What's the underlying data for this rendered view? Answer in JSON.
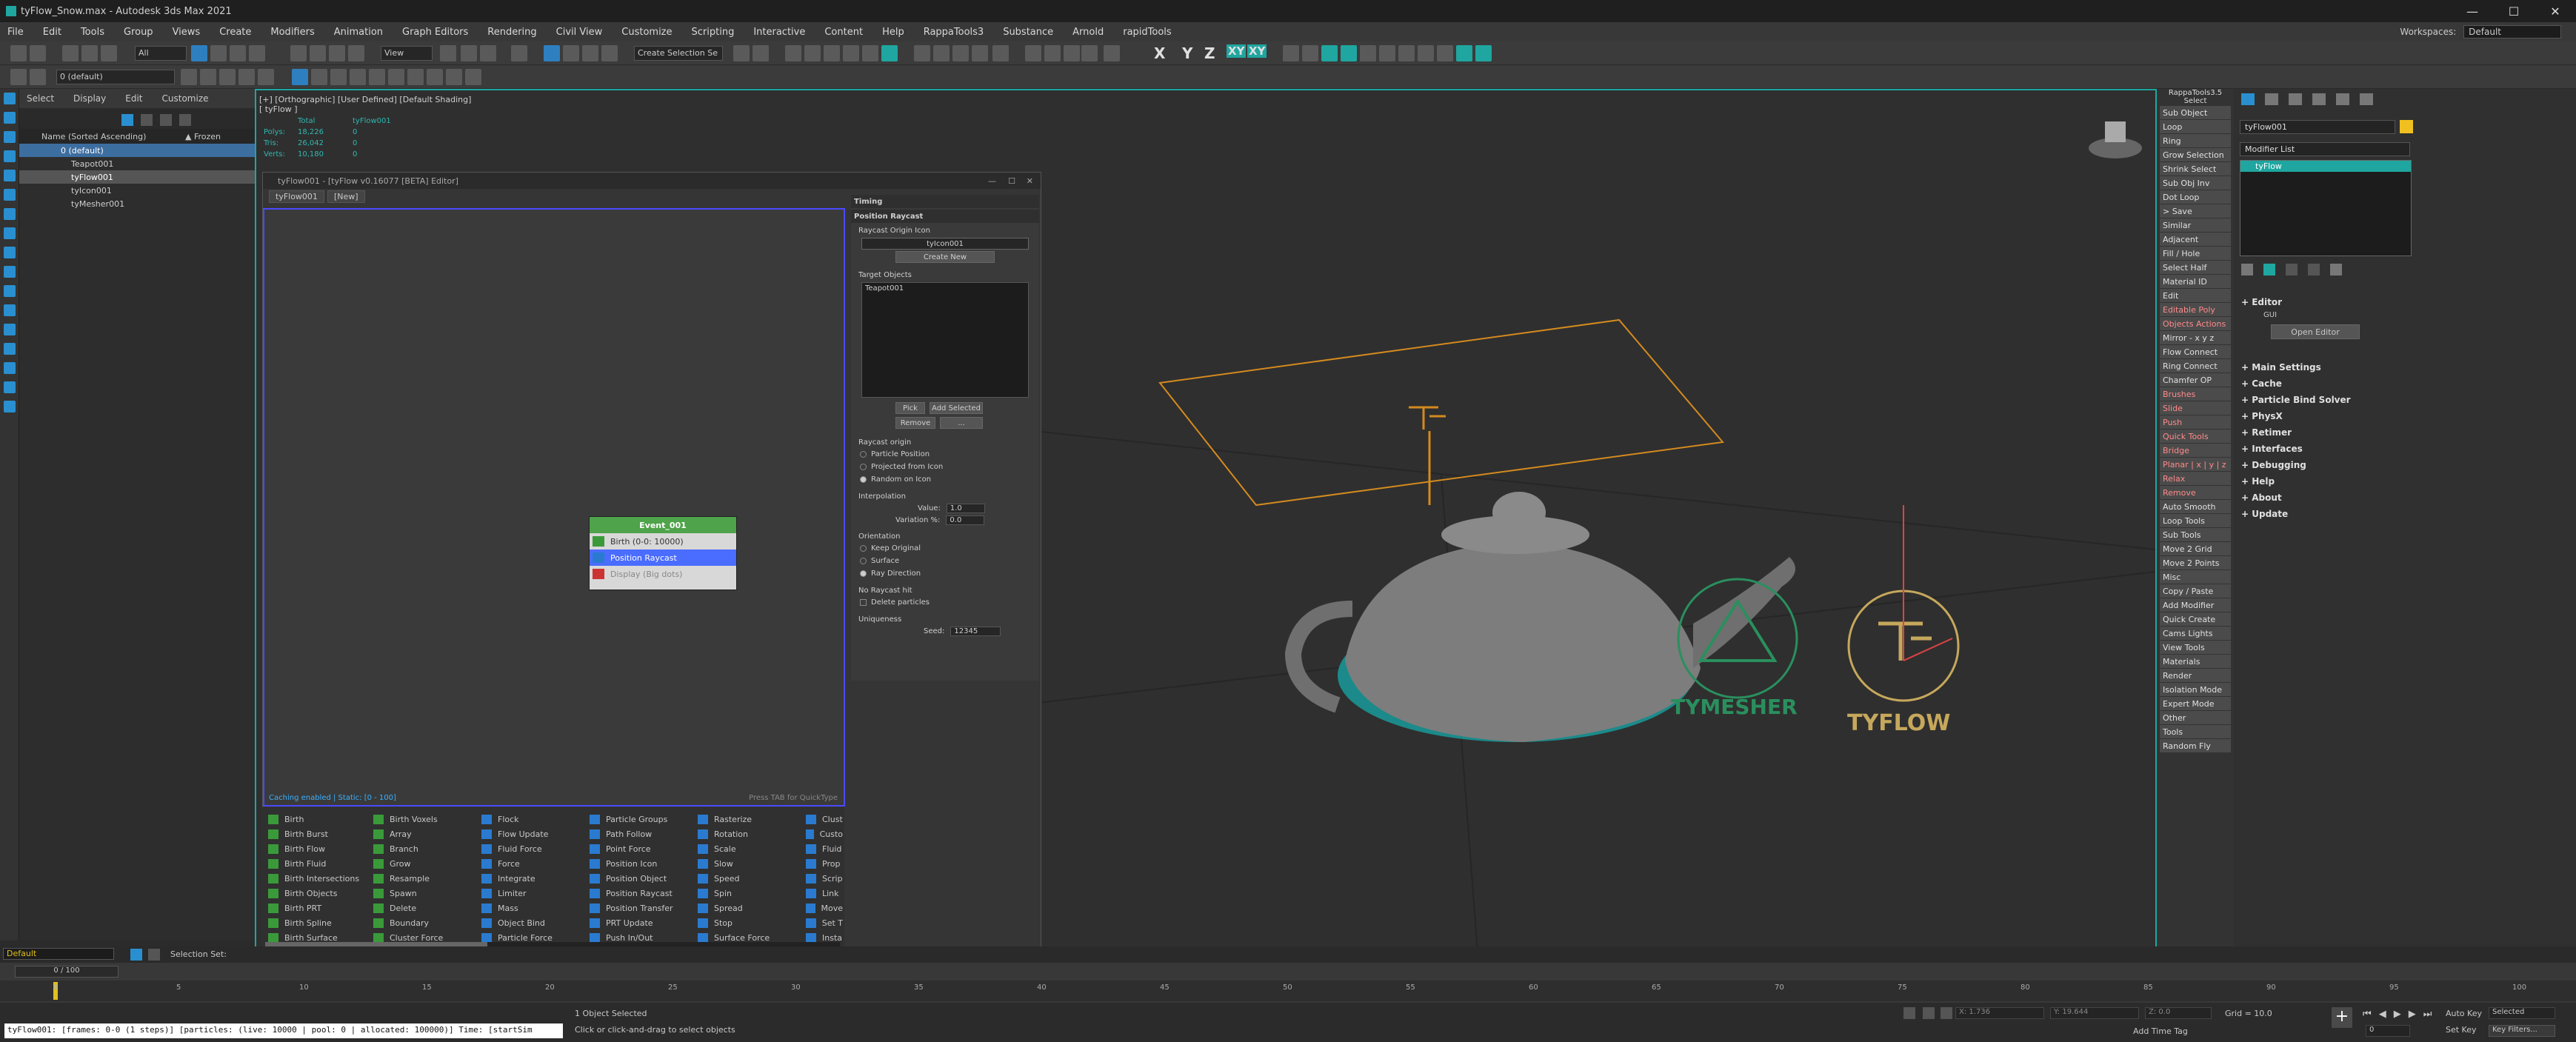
{
  "window": {
    "title": "tyFlow_Snow.max - Autodesk 3ds Max 2021"
  },
  "menus": [
    "File",
    "Edit",
    "Tools",
    "Group",
    "Views",
    "Create",
    "Modifiers",
    "Animation",
    "Graph Editors",
    "Rendering",
    "Civil View",
    "Customize",
    "Scripting",
    "Interactive",
    "Content",
    "Help",
    "RappaTools3",
    "Substance",
    "Arnold",
    "rapidTools"
  ],
  "workspaces": {
    "label": "Workspaces:",
    "value": "Default"
  },
  "toolbar": {
    "filter": "All",
    "view": "View",
    "selection_set": "Create Selection Se",
    "layer": "0 (default)",
    "axes": [
      "X",
      "Y",
      "Z",
      "XY",
      "XY"
    ]
  },
  "scene_explorer": {
    "tabs": [
      "Select",
      "Display",
      "Edit",
      "Customize"
    ],
    "col_name": "Name (Sorted Ascending)",
    "col_frozen": "▲ Frozen",
    "items": [
      "0 (default)",
      "Teapot001",
      "tyFlow001",
      "tyIcon001",
      "tyMesher001"
    ]
  },
  "viewport": {
    "label": "[+] [Orthographic] [User Defined] [Default Shading]",
    "sublabel": "[ tyFlow ]",
    "stats": {
      "h1": "Total",
      "h2": "tyFlow001",
      "rows": [
        [
          "Polys:",
          "18,226",
          "0"
        ],
        [
          "Tris:",
          "26,042",
          "0"
        ],
        [
          "Verts:",
          "10,180",
          "0"
        ]
      ]
    },
    "logos": {
      "tymesher": "TYMESHER",
      "tyflow": "TYFLOW"
    }
  },
  "editor": {
    "title": "tyFlow001 - [tyFlow v0.16077 [BETA] Editor]",
    "tabs": [
      "tyFlow001",
      "[New]"
    ],
    "footer_left": "Caching enabled | Static: [0 - 100]",
    "footer_right": "Press TAB for QuickType",
    "event": {
      "name": "Event_001",
      "operators": [
        "Birth (0-0: 10000)",
        "Position Raycast",
        "Display (Big dots)"
      ]
    },
    "props": {
      "timing": "Timing",
      "section": "Position Raycast",
      "raycast_icon_label": "Raycast Origin Icon",
      "raycast_icon_value": "tyIcon001",
      "create_new": "Create New",
      "target_label": "Target Objects",
      "targets": [
        "Teapot001"
      ],
      "pick": "Pick",
      "add_selected": "Add Selected",
      "remove": "Remove",
      "more": "...",
      "origin_label": "Raycast origin",
      "origin_opts": [
        "Particle Position",
        "Projected from Icon",
        "Random on Icon"
      ],
      "interp_label": "Interpolation",
      "value_label": "Value:",
      "value": "1.0",
      "variation_label": "Variation %:",
      "variation": "0.0",
      "orient_label": "Orientation",
      "orient_opts": [
        "Keep Original",
        "Surface",
        "Ray Direction"
      ],
      "nohit_label": "No Raycast hit",
      "delete_particles": "Delete particles",
      "uniq_label": "Uniqueness",
      "seed_label": "Seed:",
      "seed": "12345"
    },
    "operators": [
      [
        "Birth",
        "Birth Burst",
        "Birth Flow",
        "Birth Fluid",
        "Birth Intersections",
        "Birth Objects",
        "Birth PRT",
        "Birth Spline",
        "Birth Surface"
      ],
      [
        "Birth Voxels",
        "Array",
        "Branch",
        "Grow",
        "Resample",
        "Spawn",
        "Delete",
        "Boundary",
        "Cluster Force"
      ],
      [
        "Flock",
        "Flow Update",
        "Fluid Force",
        "Force",
        "Integrate",
        "Limiter",
        "Mass",
        "Object Bind",
        "Particle Force"
      ],
      [
        "Particle Groups",
        "Path Follow",
        "Point Force",
        "Position Icon",
        "Position Object",
        "Position Raycast",
        "Position Transfer",
        "PRT Update",
        "Push In/Out"
      ],
      [
        "Rasterize",
        "Rotation",
        "Scale",
        "Slow",
        "Speed",
        "Spin",
        "Spread",
        "Stop",
        "Surface Force"
      ],
      [
        "Clust",
        "Custo",
        "Fluid",
        "Prop",
        "Scrip",
        "Link",
        "Move",
        "Set T",
        "Insta"
      ]
    ]
  },
  "rappatools": {
    "title": "RappaTools3.5",
    "subtitle": "Select",
    "items": [
      "Sub Object",
      "Loop",
      "Ring",
      "Grow Selection",
      "Shrink Select",
      "Sub Obj Inv",
      "Dot Loop",
      "> Save",
      "Similar",
      "Adjacent",
      "Fill / Hole",
      "Select Half",
      "Material ID",
      "Edit",
      "Editable Poly",
      "Objects Actions",
      "Mirror - x y z",
      "Flow Connect",
      "Ring Connect",
      "Chamfer OP",
      "Brushes",
      "Slide",
      "Push",
      "Quick Tools",
      "Bridge",
      "Planar | x | y | z",
      "Relax",
      "Remove",
      "Auto Smooth",
      "Loop Tools",
      "Sub Tools",
      "Move 2 Grid",
      "Move 2 Points",
      "Misc",
      "Copy / Paste",
      "Add Modifier",
      "Quick Create",
      "Cams Lights",
      "View Tools",
      "Materials",
      "Render",
      "Isolation Mode",
      "Expert Mode",
      "Other",
      "Tools",
      "Random Fly"
    ],
    "red_items": [
      "Editable Poly",
      "Objects Actions",
      "Brushes",
      "Slide",
      "Push",
      "Quick Tools",
      "Bridge",
      "Planar | x | y | z",
      "Relax",
      "Remove"
    ]
  },
  "command_panel": {
    "object_name": "tyFlow001",
    "modifier_list": "Modifier List",
    "stack_item": "tyFlow",
    "editor_section": "Editor",
    "gui_label": "GUI",
    "open_editor": "Open Editor",
    "rollouts": [
      "Main Settings",
      "Cache",
      "Particle Bind Solver",
      "PhysX",
      "Retimer",
      "Interfaces",
      "Debugging",
      "Help",
      "About",
      "Update"
    ]
  },
  "timeline": {
    "frame": "0 / 100",
    "ticks": [
      "0",
      "5",
      "10",
      "15",
      "20",
      "25",
      "30",
      "35",
      "40",
      "45",
      "50",
      "55",
      "60",
      "65",
      "70",
      "75",
      "80",
      "85",
      "90",
      "95",
      "100"
    ]
  },
  "status": {
    "layer": "Default",
    "selection_set": "Selection Set:",
    "selected": "1 Object Selected",
    "prompt": "Click or click-and-drag to select objects",
    "listener": "tyFlow001: [frames: 0-0 (1 steps)] [particles: (live: 10000 | pool: 0 | allocated: 100000)] Time: [startSim",
    "x": "X: 1.736",
    "y": "Y: 19.644",
    "z": "Z: 0.0",
    "grid": "Grid = 10.0",
    "add_time_tag": "Add Time Tag",
    "auto_key": "Auto Key",
    "selected_dd": "Selected",
    "set_key": "Set Key",
    "key_filters": "Key Filters..."
  }
}
